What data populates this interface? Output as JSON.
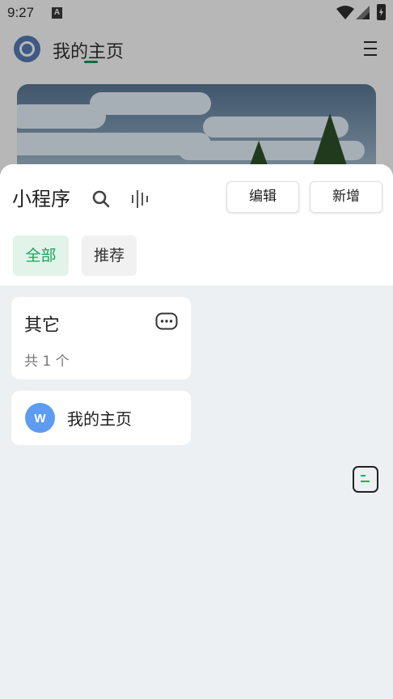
{
  "status_bar": {
    "time": "9:27",
    "notification_letter": "A"
  },
  "background_app": {
    "title": "我的主页"
  },
  "sheet": {
    "title": "小程序",
    "edit_label": "编辑",
    "add_label": "新增",
    "tabs": [
      {
        "label": "全部",
        "selected": true
      },
      {
        "label": "推荐",
        "selected": false
      }
    ],
    "group": {
      "name": "其它",
      "count_text": "共 1 个"
    },
    "apps": [
      {
        "name": "我的主页",
        "avatar_letter": "w",
        "avatar_color": "#5d9cf0"
      }
    ]
  },
  "colors": {
    "accent": "#17a65c",
    "accent_bg": "#e2f3e9",
    "sheet_bg": "#ecf0f3"
  }
}
